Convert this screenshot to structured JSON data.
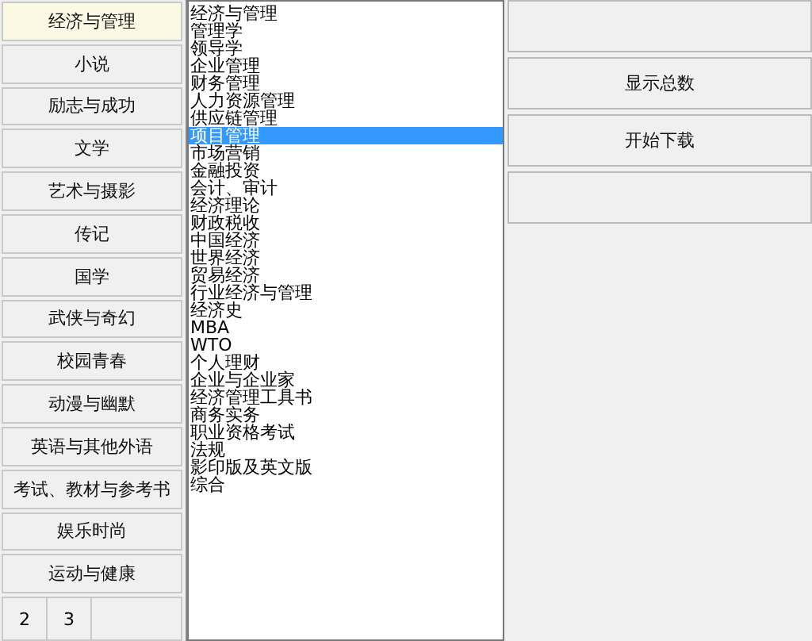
{
  "categories": [
    {
      "label": "经济与管理",
      "selected": true
    },
    {
      "label": "小说",
      "selected": false
    },
    {
      "label": "励志与成功",
      "selected": false
    },
    {
      "label": "文学",
      "selected": false
    },
    {
      "label": "艺术与摄影",
      "selected": false
    },
    {
      "label": "传记",
      "selected": false
    },
    {
      "label": "国学",
      "selected": false
    },
    {
      "label": "武侠与奇幻",
      "selected": false
    },
    {
      "label": "校园青春",
      "selected": false
    },
    {
      "label": "动漫与幽默",
      "selected": false
    },
    {
      "label": "英语与其他外语",
      "selected": false
    },
    {
      "label": "考试、教材与参考书",
      "selected": false
    },
    {
      "label": "娱乐时尚",
      "selected": false
    },
    {
      "label": "运动与健康",
      "selected": false
    }
  ],
  "pages": [
    "2",
    "3"
  ],
  "subcategories": [
    {
      "label": "经济与管理",
      "selected": false
    },
    {
      "label": "管理学",
      "selected": false
    },
    {
      "label": "领导学",
      "selected": false
    },
    {
      "label": "企业管理",
      "selected": false
    },
    {
      "label": "财务管理",
      "selected": false
    },
    {
      "label": "人力资源管理",
      "selected": false
    },
    {
      "label": "供应链管理",
      "selected": false
    },
    {
      "label": "项目管理",
      "selected": true
    },
    {
      "label": "市场营销",
      "selected": false
    },
    {
      "label": "金融投资",
      "selected": false
    },
    {
      "label": "会计、审计",
      "selected": false
    },
    {
      "label": "经济理论",
      "selected": false
    },
    {
      "label": "财政税收",
      "selected": false
    },
    {
      "label": "中国经济",
      "selected": false
    },
    {
      "label": "世界经济",
      "selected": false
    },
    {
      "label": "贸易经济",
      "selected": false
    },
    {
      "label": "行业经济与管理",
      "selected": false
    },
    {
      "label": "经济史",
      "selected": false
    },
    {
      "label": "MBA",
      "selected": false
    },
    {
      "label": "WTO",
      "selected": false
    },
    {
      "label": "个人理财",
      "selected": false
    },
    {
      "label": "企业与企业家",
      "selected": false
    },
    {
      "label": "经济管理工具书",
      "selected": false
    },
    {
      "label": "商务实务",
      "selected": false
    },
    {
      "label": "职业资格考试",
      "selected": false
    },
    {
      "label": "法规",
      "selected": false
    },
    {
      "label": "影印版及英文版",
      "selected": false
    },
    {
      "label": "综合",
      "selected": false
    }
  ],
  "actions": [
    {
      "label": "显示总数"
    },
    {
      "label": "开始下载"
    }
  ]
}
